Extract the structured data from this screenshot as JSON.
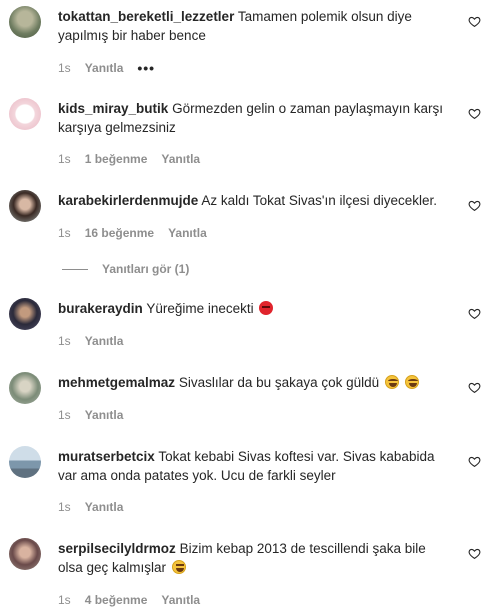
{
  "labels": {
    "reply": "Yanıtla",
    "more": "•••",
    "view_replies": "Yanıtları gör (1)"
  },
  "colors": {
    "text": "#262626",
    "muted": "#8e8e8e",
    "heart_outline": "#262626"
  },
  "comments": [
    {
      "username": "tokattan_bereketli_lezzetler",
      "text": "Tamamen polemik olsun diye yapılmış bir haber bence",
      "time": "1s",
      "likes": "",
      "avatar_color": "#7c8a70",
      "emoji": ""
    },
    {
      "username": "kids_miray_butik",
      "text": "Görmezden gelin o zaman paylaşmayın karşı karşıya gelmezsiniz",
      "time": "1s",
      "likes": "1 beğenme",
      "avatar_color": "#f3d6dc",
      "emoji": ""
    },
    {
      "username": "karabekirlerdenmujde",
      "text": "Az kaldı Tokat Sivas'ın ilçesi diyecekler.",
      "time": "1s",
      "likes": "16 beğenme",
      "avatar_color": "#4a3b35",
      "emoji": ""
    },
    {
      "username": "burakeraydin",
      "text": "Yüreğime inecekti",
      "time": "1s",
      "likes": "",
      "avatar_color": "#2b2a3a",
      "emoji": "angry-face-emoji"
    },
    {
      "username": "mehmetgemalmaz",
      "text": "Sivaslılar da bu şakaya çok güldü",
      "time": "1s",
      "likes": "",
      "avatar_color": "#8a9a86",
      "emoji": "tears-of-joy-emoji"
    },
    {
      "username": "muratserbetcix",
      "text": "Tokat kebabi Sivas koftesi var. Sivas kababida var ama onda patates yok. Ucu de farkli seyler",
      "time": "1s",
      "likes": "",
      "avatar_color": "#9fb4c4",
      "emoji": ""
    },
    {
      "username": "serpilsecilyldrmoz",
      "text": "Bizim kebap 2013 de tescillendi şaka bile olsa geç kalmışlar",
      "time": "1s",
      "likes": "4 beğenme",
      "avatar_color": "#6a4a4a",
      "emoji": "grinning-face-emoji"
    }
  ]
}
